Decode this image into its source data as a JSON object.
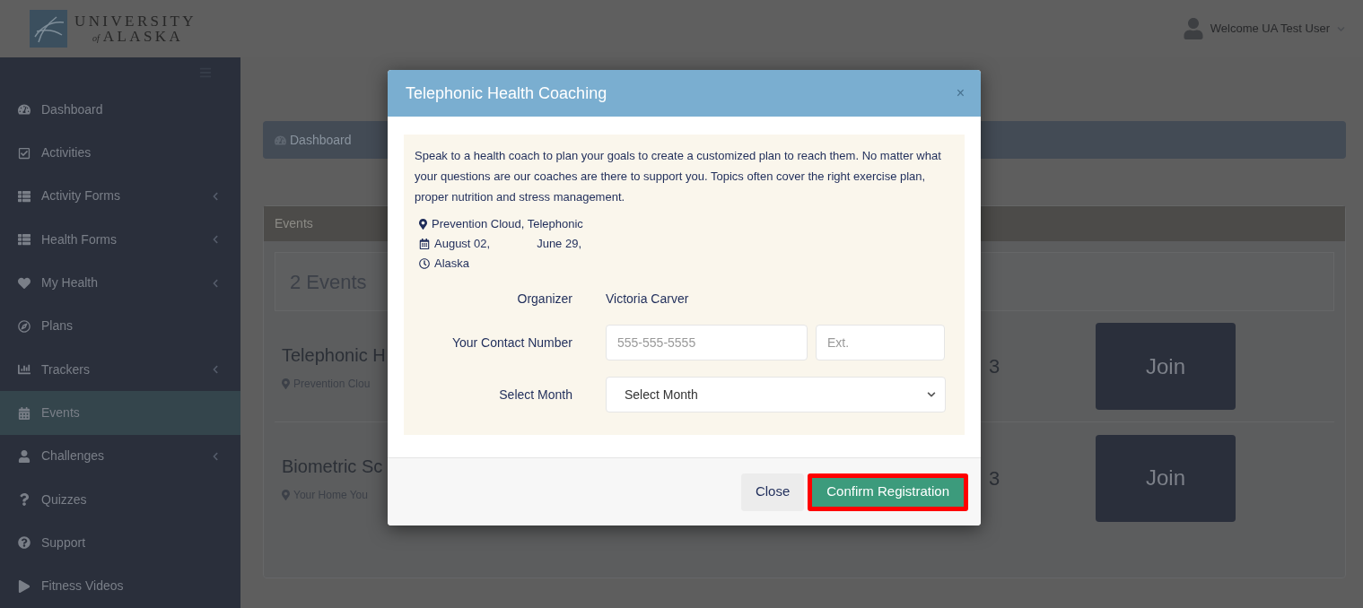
{
  "header": {
    "logo": {
      "line1": "UNIVERSITY",
      "line2_prefix": "of",
      "line2": "ALASKA"
    },
    "user": {
      "greeting": "Welcome UA Test User"
    }
  },
  "sidebar": {
    "items": [
      {
        "label": "Dashboard",
        "has_submenu": false,
        "selected": false
      },
      {
        "label": "Activities",
        "has_submenu": false,
        "selected": false
      },
      {
        "label": "Activity Forms",
        "has_submenu": true,
        "selected": false
      },
      {
        "label": "Health Forms",
        "has_submenu": true,
        "selected": false
      },
      {
        "label": "My Health",
        "has_submenu": true,
        "selected": false
      },
      {
        "label": "Plans",
        "has_submenu": false,
        "selected": false
      },
      {
        "label": "Trackers",
        "has_submenu": true,
        "selected": false
      },
      {
        "label": "Events",
        "has_submenu": false,
        "selected": true
      },
      {
        "label": "Challenges",
        "has_submenu": true,
        "selected": false
      },
      {
        "label": "Quizzes",
        "has_submenu": false,
        "selected": false
      },
      {
        "label": "Support",
        "has_submenu": false,
        "selected": false
      },
      {
        "label": "Fitness Videos",
        "has_submenu": false,
        "selected": false
      }
    ]
  },
  "breadcrumb": {
    "items": [
      "Dashboard"
    ]
  },
  "events_panel": {
    "title": "Events",
    "count": "2 Events",
    "events": [
      {
        "title": "Telephonic H",
        "location": "Prevention Clou",
        "date": "3",
        "button": "Join"
      },
      {
        "title": "Biometric Sc",
        "location": "Your Home You",
        "date": "3",
        "button": "Join"
      }
    ]
  },
  "modal": {
    "title": "Telephonic Health Coaching",
    "close_symbol": "×",
    "description": "Speak to a health coach to plan your goals to create a customized plan to reach them. No matter what your questions are our coaches are there to support you. Topics often cover the right exercise plan, proper nutrition and stress management.",
    "location": "Prevention Cloud, Telephonic",
    "dates": [
      "August 02,",
      "June 29,"
    ],
    "timezone": "Alaska",
    "organizer": {
      "label": "Organizer",
      "value": "Victoria Carver"
    },
    "contact": {
      "label": "Your Contact Number",
      "placeholder": "555-555-5555",
      "ext_placeholder": "Ext."
    },
    "month": {
      "label": "Select Month",
      "value": "Select Month"
    },
    "buttons": [
      {
        "label": "Close",
        "kind": "secondary",
        "highlighted": false
      },
      {
        "label": "Confirm Registration",
        "kind": "primary",
        "highlighted": true
      }
    ]
  }
}
